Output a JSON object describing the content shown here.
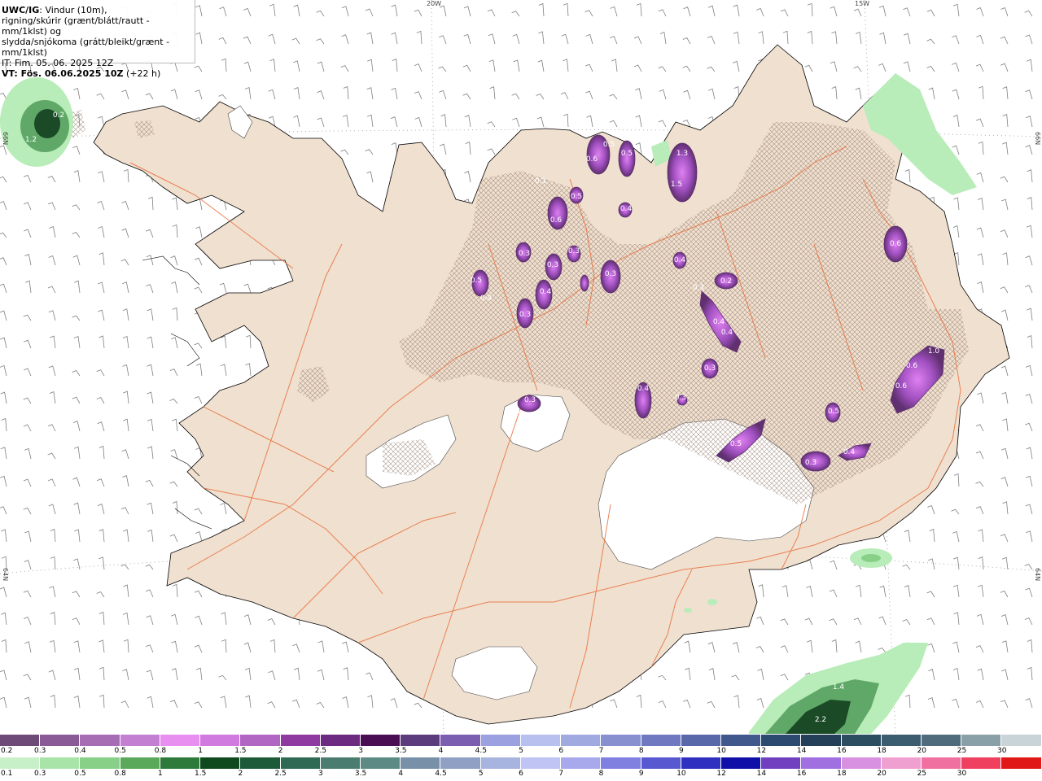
{
  "header": {
    "model": "UWC/IG",
    "line1_rest": ": Vindur (10m),",
    "line2": "rigning/skúrir (grænt/blátt/rautt - mm/1klst) og",
    "line3": "slydda/snjókoma (grátt/bleikt/grænt - mm/1klst)",
    "init_time": "IT: Fim. 05. 06. 2025 12Z",
    "valid_time_label": "VT: Fös. 06.06.2025 10Z",
    "lead_time": "(+22 h)"
  },
  "grid_labels": {
    "lon_20w": "20W",
    "lon_15w": "15W",
    "lat_66n_left": "66N",
    "lat_66n_right": "66N",
    "lat_64n_left": "64N",
    "lat_64n_right": "64N"
  },
  "colors": {
    "land": "#f0e0d0",
    "roads": "#e8703c",
    "snow_purple": "#a040c0",
    "rain_green": "#80d080",
    "rain_dark_green": "#1e5a30"
  },
  "snow_labels": [
    "0.2",
    "1.2",
    "0.5",
    "0.5",
    "1.3",
    "0.6",
    "1.5",
    "0.1",
    "0.6",
    "0.5",
    "0.4",
    "0.3",
    "0.3",
    "0.3",
    "0.4",
    "0.3",
    "0.5",
    "0.4",
    "0.3",
    "0.4",
    "0.2",
    "0.3",
    "0.4",
    "0.4",
    "0.6",
    "1.0",
    "0.6",
    "0.6",
    "0.3",
    "0.4",
    "0.3",
    "0.3",
    "0.3",
    "0.5",
    "0.5",
    "0.3",
    "0.4",
    "1.4",
    "2.2"
  ],
  "legend_snow": {
    "labels": [
      "0.2",
      "0.3",
      "0.4",
      "0.5",
      "0.8",
      "1",
      "1.5",
      "2",
      "2.5",
      "3",
      "3.5",
      "4",
      "4.5",
      "5",
      "6",
      "7",
      "8",
      "9",
      "10",
      "12",
      "14",
      "16",
      "18",
      "20",
      "25",
      "30"
    ],
    "colors": [
      "#6e4a78",
      "#8a5a96",
      "#a66cb4",
      "#c37fd2",
      "#e88ef0",
      "#d07ae0",
      "#b266c4",
      "#8f3aa0",
      "#6c2a80",
      "#4a0e54",
      "#5c3c7c",
      "#7c5eb0",
      "#9aa0e0",
      "#b8c0f0",
      "#a0aae0",
      "#8890d0",
      "#7078c0",
      "#5868a8",
      "#40588c",
      "#2c4a70",
      "#244058",
      "#2c4c60",
      "#3c5c70",
      "#4e6c7c",
      "#8aa0a8",
      "#c8d4d8"
    ]
  },
  "legend_rain": {
    "labels": [
      "0.1",
      "0.3",
      "0.5",
      "0.8",
      "1",
      "1.5",
      "2",
      "2.5",
      "3",
      "3.5",
      "4",
      "4.5",
      "5",
      "6",
      "7",
      "8",
      "9",
      "10",
      "12",
      "14",
      "16",
      "18",
      "20",
      "25",
      "30"
    ],
    "colors": [
      "#c8f0c8",
      "#a8e4a8",
      "#88d088",
      "#5aa85a",
      "#2e7a3a",
      "#0e4a1e",
      "#1c5a3a",
      "#2e6a54",
      "#4a7c70",
      "#5e8a86",
      "#7890a8",
      "#90a0c4",
      "#a8b4e0",
      "#c0c4f4",
      "#a8a8ec",
      "#8080e0",
      "#5858d0",
      "#3030c0",
      "#1010a8",
      "#7040c0",
      "#a070e0",
      "#d890e0",
      "#f0a0d0",
      "#f070a0",
      "#f04060",
      "#e01818"
    ]
  }
}
